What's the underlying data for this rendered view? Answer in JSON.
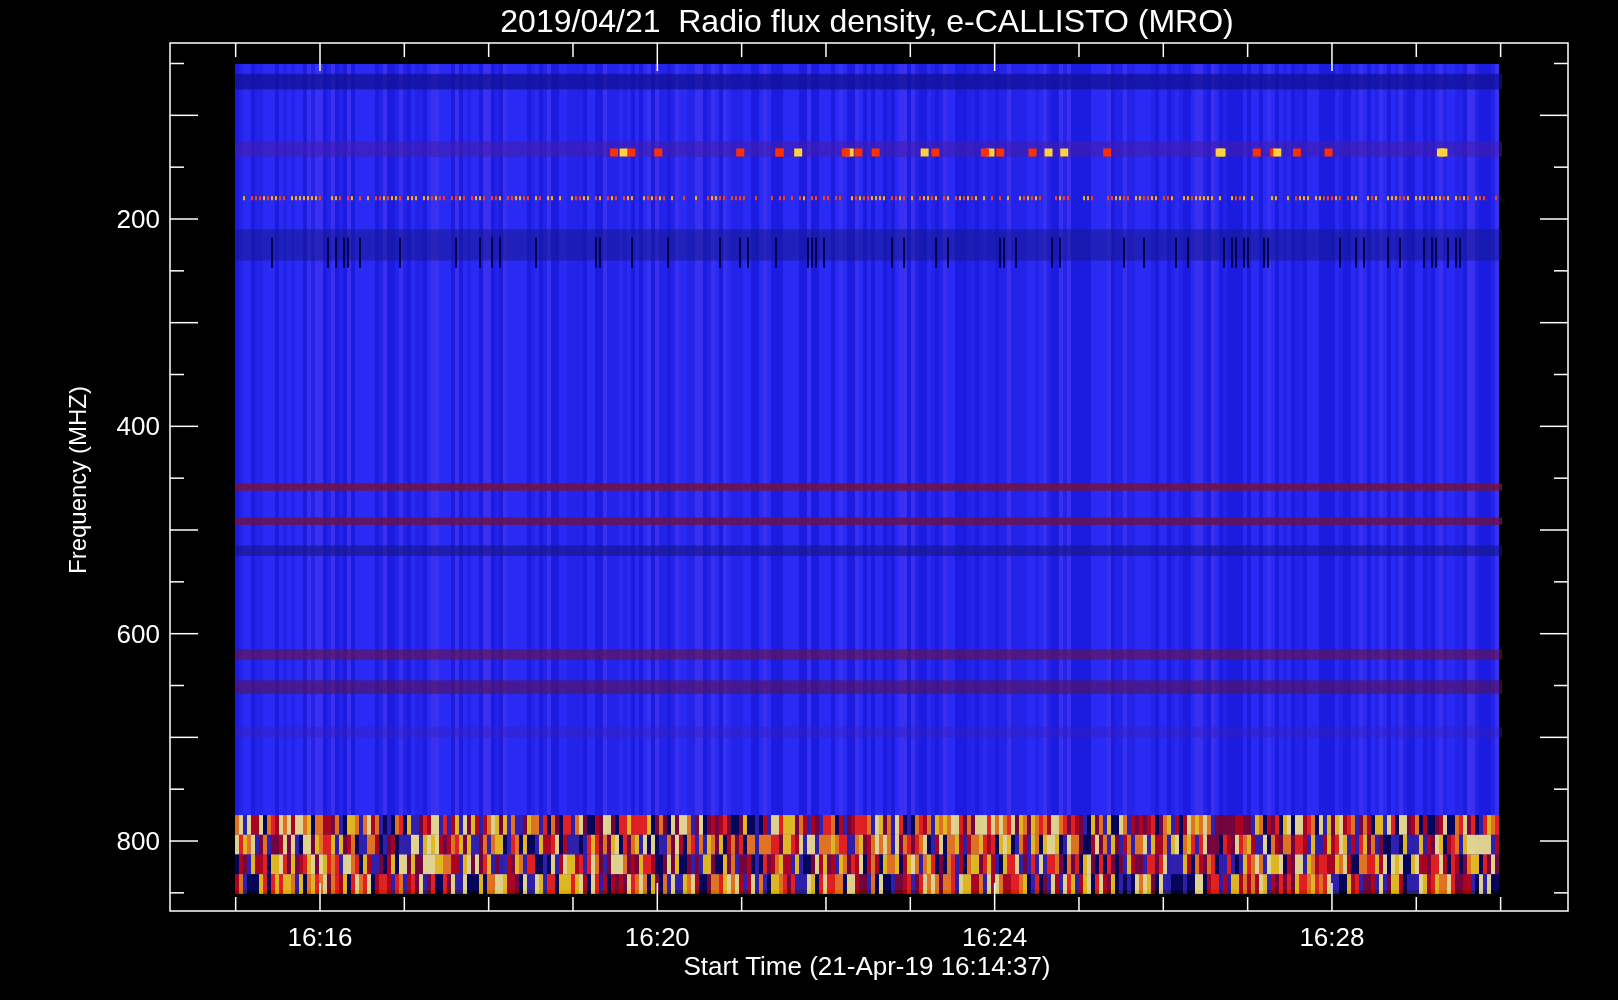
{
  "title": "2019/04/21  Radio flux density, e-CALLISTO (MRO)",
  "y_axis": {
    "label": "Frequency (MHZ)",
    "ticks": [
      "200",
      "400",
      "600",
      "800"
    ]
  },
  "x_axis": {
    "label": "Start Time (21-Apr-19 16:14:37)",
    "ticks": [
      "16:16",
      "16:20",
      "16:24",
      "16:28"
    ]
  }
}
